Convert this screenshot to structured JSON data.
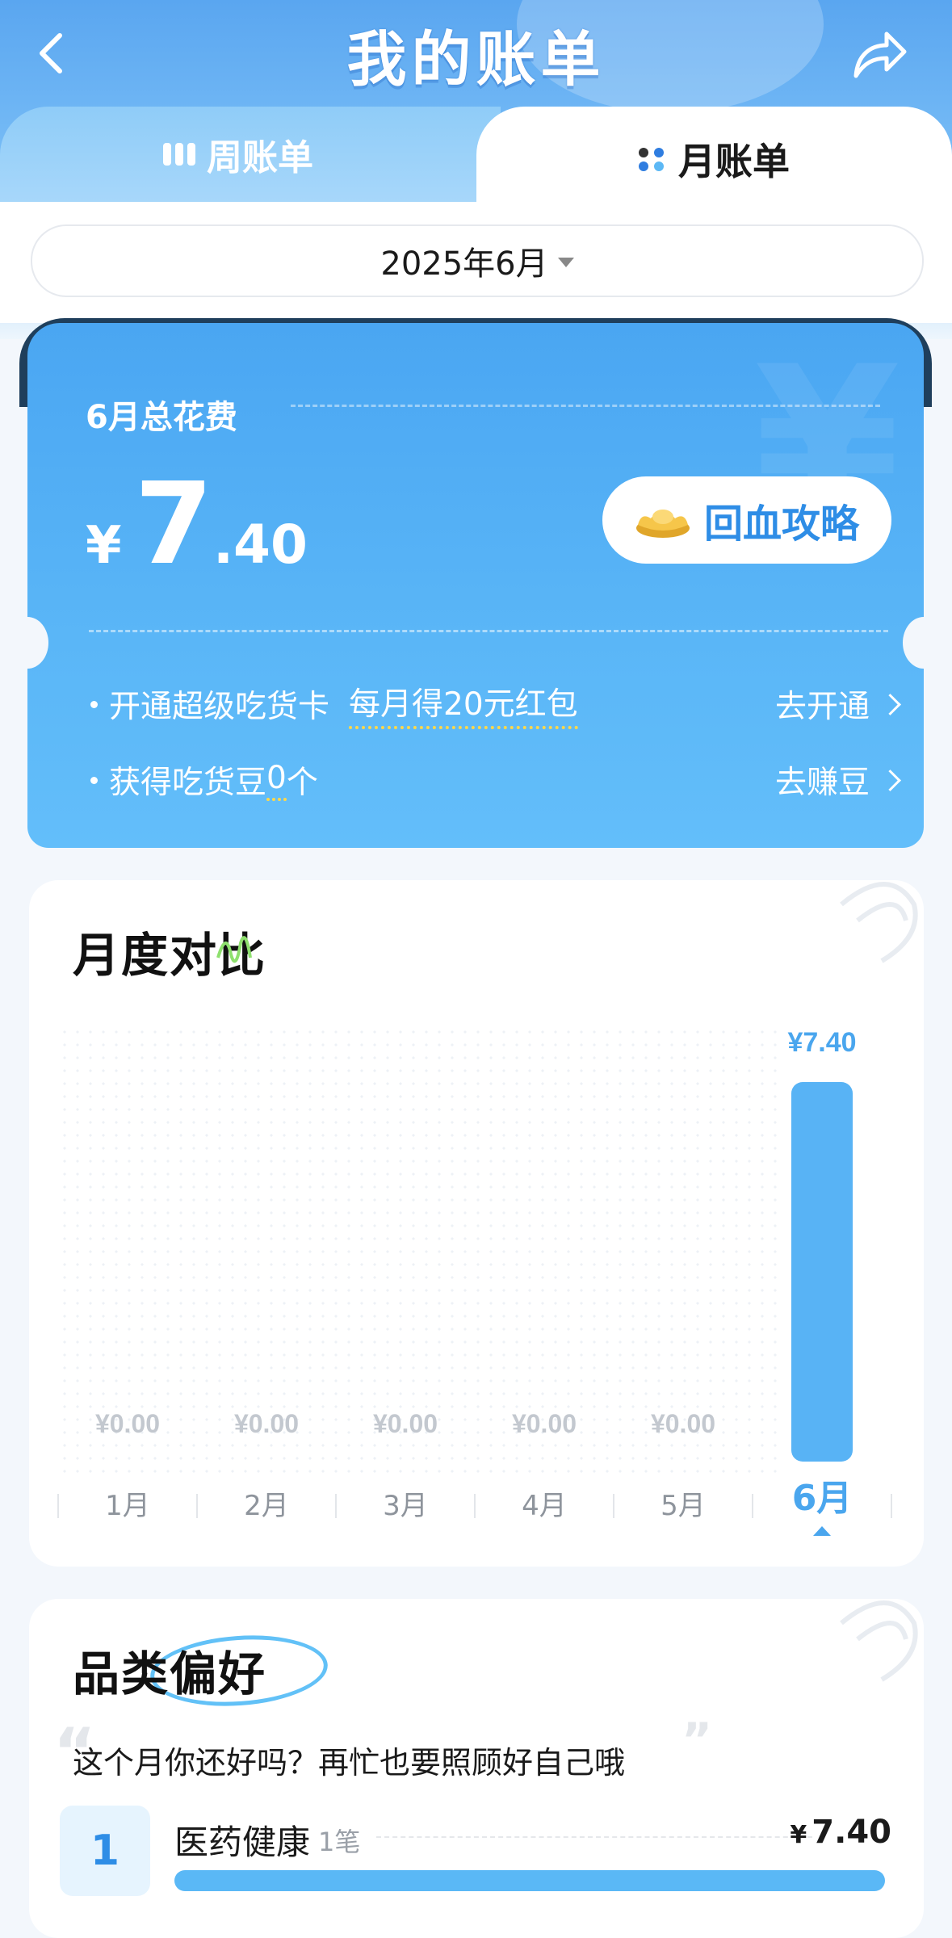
{
  "header": {
    "title": "我的账单",
    "back_icon": "back-icon",
    "share_icon": "share-icon"
  },
  "tabs": [
    {
      "label": "周账单",
      "icon": "bars-icon",
      "active": false
    },
    {
      "label": "月账单",
      "icon": "dots-icon",
      "active": true
    }
  ],
  "date_picker": {
    "value": "2025年6月",
    "icon": "caret-down-icon"
  },
  "summary": {
    "label": "6月总花费",
    "currency": "¥",
    "amount_int": "7",
    "amount_dec": ".40",
    "recover_button": "回血攻略",
    "rows": [
      {
        "text": "开通超级吃货卡",
        "highlight": "每月得20元红包",
        "action": "去开通"
      },
      {
        "text": "获得吃货豆",
        "highlight": "0",
        "suffix": "个",
        "action": "去赚豆"
      }
    ]
  },
  "comparison": {
    "title": "月度对比"
  },
  "chart_data": {
    "type": "bar",
    "categories": [
      "1月",
      "2月",
      "3月",
      "4月",
      "5月",
      "6月"
    ],
    "values": [
      0.0,
      0.0,
      0.0,
      0.0,
      0.0,
      7.4
    ],
    "value_labels": [
      "¥0.00",
      "¥0.00",
      "¥0.00",
      "¥0.00",
      "¥0.00",
      "¥7.40"
    ],
    "highlight_index": 5,
    "colors": {
      "bar": "#58b3f5",
      "highlight_label": "#4aa6ee",
      "muted_label": "#c3c8cf"
    }
  },
  "categories": {
    "title": "品类偏好",
    "subtitle": "这个月你还好吗？再忙也要照顾好自己哦",
    "items": [
      {
        "rank": "1",
        "name": "医药健康",
        "count": "1笔",
        "currency": "¥",
        "amount": "7.40",
        "share": 1.0
      }
    ]
  }
}
